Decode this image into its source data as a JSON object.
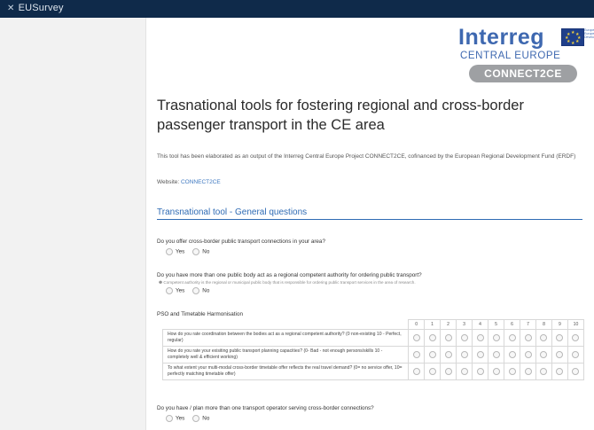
{
  "app": {
    "name": "EUSurvey",
    "icon": "eusurvey-logo-icon"
  },
  "brand": {
    "wordmark": "Interreg",
    "eu_text": "European Union European Regional Development Fund",
    "subtitle": "CENTRAL EUROPE",
    "project": "CONNECT2CE",
    "colors": {
      "blue": "#3e68b0",
      "pill": "#9ea0a3"
    }
  },
  "survey": {
    "title": "Trasnational tools for fostering regional and cross-border passenger transport in the CE area",
    "description": "This tool has been elaborated as an output of the Interreg Central Europe Project CONNECT2CE, cofinanced by the European Regional Development Fund (ERDF)",
    "website_label": "Website:",
    "website_link": "CONNECT2CE",
    "section_title": "Transnational tool - General questions"
  },
  "questions": [
    {
      "text": "Do you offer cross-border public transport connections in your area?",
      "options": [
        "Yes",
        "No"
      ]
    },
    {
      "text": "Do you have more than one public body act as a regional competent authority for ordering public transport?",
      "note": "Competent authority is the regional or municipal public body that is responsible for ordering public transport services in the area of research.",
      "options": [
        "Yes",
        "No"
      ]
    },
    {
      "text": "Do you have / plan more than one transport operator serving cross-border connections?",
      "options": [
        "Yes",
        "No"
      ]
    }
  ],
  "matrix": {
    "title": "PSO and Timetable Harmonisation",
    "columns": [
      "0",
      "1",
      "2",
      "3",
      "4",
      "5",
      "6",
      "7",
      "8",
      "9",
      "10"
    ],
    "rows": [
      "How do you rate coordination between the bodies act as a regional competent authority? (0 non-existing 10 - Perfect, regular)",
      "How do you rate your exisiting public transport planning capacities? (0- Bad - not enough persons/skills 10 - completely well & efficient working)",
      "To what extent your multi-modal cross-border timetable offer reflects the real travel demand? (0= no service offer, 10= perfectly matching timetable offer)"
    ]
  }
}
